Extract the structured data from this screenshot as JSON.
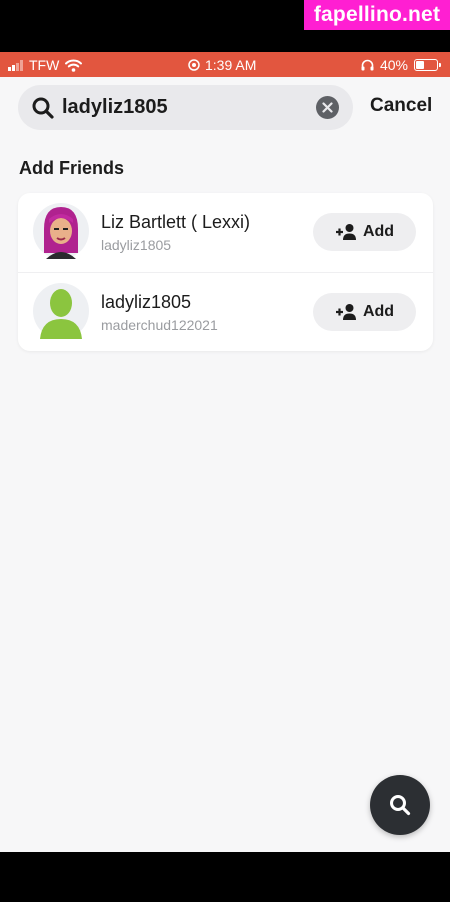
{
  "watermark": "fapellino.net",
  "status_bar": {
    "carrier": "TFW",
    "time": "1:39 AM",
    "battery": "40%",
    "battery_level": 0.4,
    "color": "#e2563f"
  },
  "search": {
    "query": "ladyliz1805",
    "cancel_label": "Cancel"
  },
  "section_title": "Add Friends",
  "results": [
    {
      "display_name": "Liz Bartlett ( Lexxi)",
      "username": "ladyliz1805",
      "add_label": "Add",
      "avatar": "bitmoji-avatar"
    },
    {
      "display_name": "ladyliz1805",
      "username": "maderchud122021",
      "add_label": "Add",
      "avatar": "default-ghost-avatar"
    }
  ],
  "icons": {
    "search": "search-icon",
    "clear": "clear-icon",
    "add_friend": "add-friend-icon",
    "fab_search": "search-icon"
  },
  "colors": {
    "background": "#f7f7f8",
    "card": "#ffffff",
    "add_button": "#eeeef0",
    "default_avatar": "#8bc53f",
    "watermark": "#ff1fd2"
  }
}
